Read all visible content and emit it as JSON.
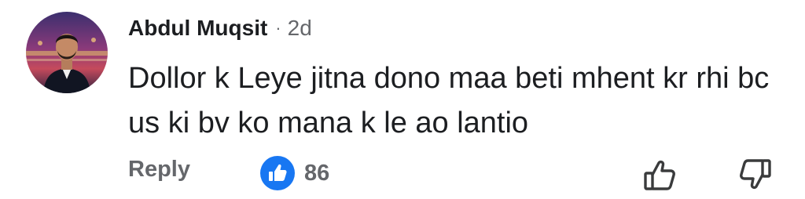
{
  "comment": {
    "author": "Abdul Muqsit",
    "separator": "·",
    "age": "2d",
    "text": "Dollor k Leye jitna dono maa beti mhent kr rhi bc us ki bv ko mana k le ao lantio"
  },
  "actions": {
    "reply_label": "Reply",
    "like_count": "86"
  },
  "icons": {
    "reaction": "like-badge-icon",
    "up": "thumb-up-outline-icon",
    "down": "thumb-down-outline-icon"
  },
  "colors": {
    "text": "#1c1e21",
    "secondary": "#65676b",
    "like_blue": "#1877f2"
  }
}
